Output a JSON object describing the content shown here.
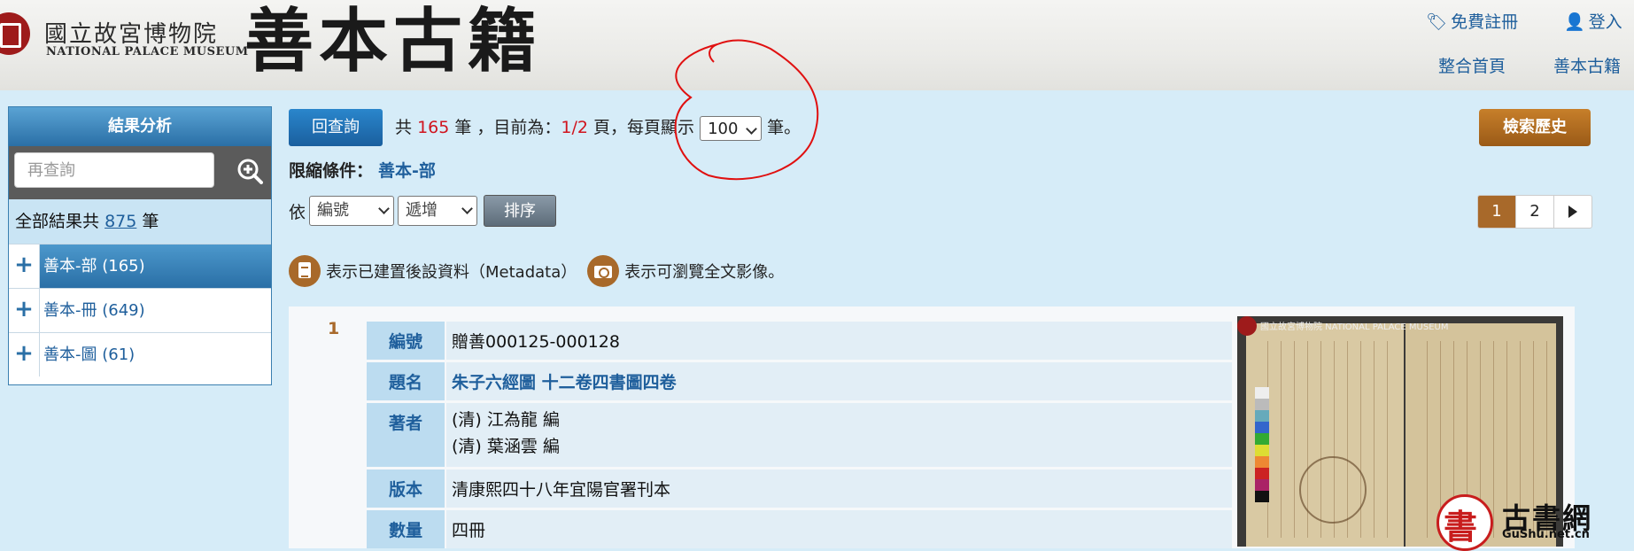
{
  "header": {
    "museum_name_zh": "國立故宮博物院",
    "museum_name_en": "NATIONAL PALACE MUSEUM",
    "site_title": "善本古籍",
    "register": "免費註冊",
    "login": "登入",
    "nav": [
      "整合首頁",
      "善本古籍"
    ]
  },
  "sidebar": {
    "title": "結果分析",
    "search_placeholder": "再查詢",
    "total_prefix": "全部結果共",
    "total_count": "875",
    "total_suffix": "筆",
    "items": [
      {
        "label": "善本-部 (165)",
        "active": true
      },
      {
        "label": "善本-冊 (649)",
        "active": false
      },
      {
        "label": "善本-圖 (61)",
        "active": false
      }
    ]
  },
  "toolbar": {
    "back_label": "回查詢",
    "count_prefix": "共",
    "count": "165",
    "count_mid": "筆 ，目前為：",
    "page_now": "1/2",
    "page_mid": "頁，每頁顯示",
    "per_page": "100",
    "per_page_suffix": "筆。",
    "history_label": "檢索歷史",
    "limit_label": "限縮條件：",
    "limit_value": "善本-部",
    "sort_prefix": "依",
    "sort_field": "編號",
    "sort_order": "遞增",
    "sort_button": "排序",
    "pages": [
      "1",
      "2"
    ]
  },
  "legend": {
    "metadata": "表示已建置後設資料（Metadata）",
    "image": "表示可瀏覽全文影像。"
  },
  "record": {
    "index": "1",
    "fields": [
      {
        "key": "編號",
        "value": [
          "贈善000125-000128"
        ],
        "link": false
      },
      {
        "key": "題名",
        "value": [
          "朱子六經圖 十二卷四書圖四卷"
        ],
        "link": true
      },
      {
        "key": "著者",
        "value": [
          "(清) 江為龍 編",
          "(清) 葉涵雲 編"
        ],
        "link": false
      },
      {
        "key": "版本",
        "value": [
          "清康熙四十八年宜陽官署刊本"
        ],
        "link": false
      },
      {
        "key": "數量",
        "value": [
          "四冊"
        ],
        "link": false
      }
    ],
    "thumbnail_caption": "國立故宮博物院 NATIONAL PALACE MUSEUM"
  },
  "watermark": {
    "char": "書",
    "name": "古書網",
    "url": "GuShu.net.cn"
  },
  "colors": {
    "accent_blue": "#1f5f9c",
    "brown": "#a8692a",
    "count_red": "#d0141e",
    "annotation_red": "#e01010"
  }
}
